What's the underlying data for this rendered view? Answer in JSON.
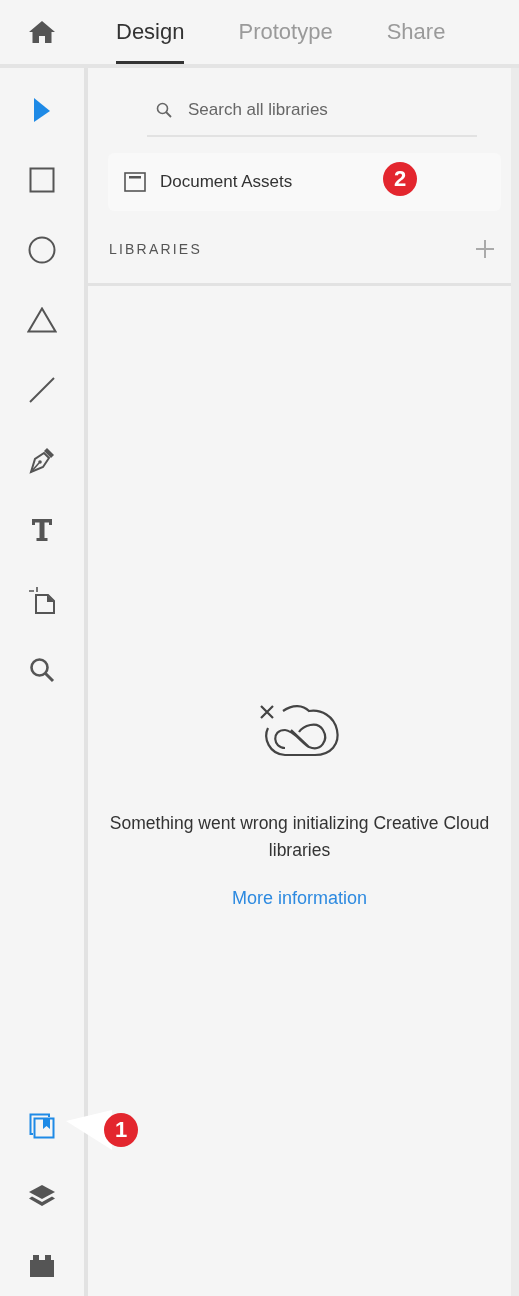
{
  "header": {
    "tabs": [
      {
        "label": "Design",
        "selected": true
      },
      {
        "label": "Prototype",
        "selected": false
      },
      {
        "label": "Share",
        "selected": false
      }
    ]
  },
  "toolbar": {
    "tools": [
      {
        "kind": "select",
        "selected": true
      },
      {
        "kind": "rectangle",
        "selected": false
      },
      {
        "kind": "ellipse",
        "selected": false
      },
      {
        "kind": "triangle",
        "selected": false
      },
      {
        "kind": "line",
        "selected": false
      },
      {
        "kind": "pen",
        "selected": false
      },
      {
        "kind": "text",
        "selected": false
      },
      {
        "kind": "artboard",
        "selected": false
      },
      {
        "kind": "zoom",
        "selected": false
      }
    ],
    "bottom_tools": [
      {
        "kind": "assets",
        "selected": true
      },
      {
        "kind": "layers",
        "selected": false
      },
      {
        "kind": "plugins",
        "selected": false
      }
    ]
  },
  "panel": {
    "search": {
      "placeholder": "Search all libraries"
    },
    "document_assets": {
      "label": "Document Assets",
      "badge": "2"
    },
    "libraries": {
      "heading": "LIBRARIES"
    },
    "error": {
      "message": "Something went wrong initializing Creative Cloud libraries",
      "link": "More information"
    }
  },
  "callout": {
    "badge": "1"
  }
}
